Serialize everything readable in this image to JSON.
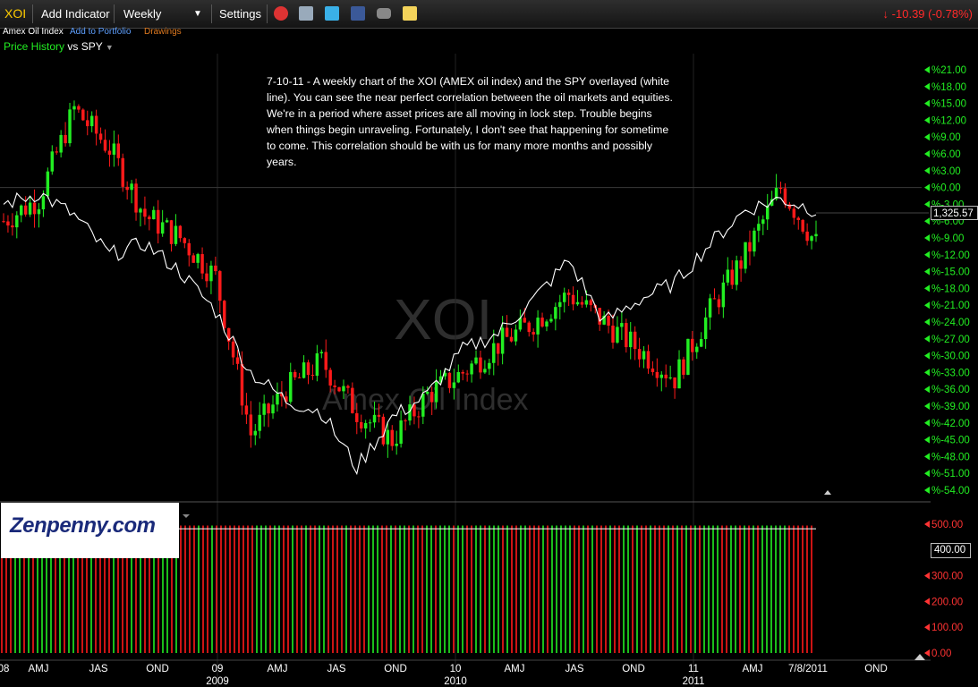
{
  "toolbar": {
    "ticker": "XOI",
    "add_indicator": "Add Indicator",
    "period": "Weekly",
    "period_caret": "▼",
    "settings": "Settings",
    "change": "-10.39 (-0.78%)",
    "change_arrow": "↓",
    "icons": [
      "alarm-clock-icon",
      "notes-icon",
      "twitter-icon",
      "facebook-icon",
      "camera-icon",
      "sticky-note-icon"
    ]
  },
  "subheader": {
    "name": "Amex Oil Index",
    "add_portfolio": "Add to Portfolio",
    "drawings": "Drawings"
  },
  "study": {
    "label": "Price History",
    "compare": "vs SPY",
    "caret": "▼"
  },
  "annotation": "7-10-11 - A weekly chart of the XOI (AMEX oil index) and the SPY overlayed (white line). You can see the near perfect correlation between the oil markets and equities. We're in a period where asset prices are all moving in lock step. Trouble begins when things begin unraveling. Fortunately, I don't see that happening for sometime to come. This correlation should be with us for many more months and possibly years.",
  "watermark": {
    "symbol": "XOI",
    "name": "Amex Oil Index"
  },
  "logo": {
    "text": "Zenpenny.com"
  },
  "current_price": "1,325.57",
  "volume_box": "400.00",
  "colors": {
    "up": "#22ee22",
    "down": "#ff1a1a",
    "spy": "#ffffff",
    "change": "#ff2a2a"
  },
  "chart_data": {
    "type": "line",
    "title": "",
    "y_ticks_pct": [
      "%21.00",
      "%18.00",
      "%15.00",
      "%12.00",
      "%9.00",
      "%6.00",
      "%3.00",
      "%0.00",
      "%-3.00",
      "%-6.00",
      "%-9.00",
      "%-12.00",
      "%-15.00",
      "%-18.00",
      "%-21.00",
      "%-24.00",
      "%-27.00",
      "%-30.00",
      "%-33.00",
      "%-36.00",
      "%-39.00",
      "%-42.00",
      "%-45.00",
      "%-48.00",
      "%-51.00",
      "%-54.00"
    ],
    "volume_ticks": [
      "500.00",
      "400.00",
      "300.00",
      "200.00",
      "100.00",
      "0.00"
    ],
    "x_labels": [
      "08",
      "AMJ",
      "JAS",
      "OND",
      "09",
      "AMJ",
      "JAS",
      "OND",
      "10",
      "AMJ",
      "JAS",
      "OND",
      "11",
      "AMJ",
      "7/8/2011",
      "OND"
    ],
    "x_years": [
      "2009",
      "2010",
      "2011"
    ],
    "series": [
      {
        "name": "Price History",
        "x": [
          0,
          8,
          16,
          24,
          32,
          40,
          48,
          56,
          64,
          72,
          80,
          88,
          96,
          104,
          112,
          120,
          128,
          136,
          144,
          152,
          160,
          168,
          176,
          184
        ],
        "values": [
          -6,
          -2,
          14,
          7,
          -5,
          -9,
          -16,
          -44,
          -36,
          -31,
          -40,
          -45,
          -37,
          -33,
          -28,
          -24,
          -19,
          -24,
          -29,
          -34,
          -22,
          -12,
          0,
          -10
        ]
      },
      {
        "name": "SPY",
        "x": [
          0,
          8,
          16,
          24,
          32,
          40,
          48,
          56,
          64,
          72,
          80,
          88,
          96,
          104,
          112,
          120,
          128,
          136,
          144,
          152,
          160,
          168,
          176,
          184
        ],
        "values": [
          -3,
          -1,
          -5,
          -12,
          -10,
          -15,
          -22,
          -33,
          -38,
          -40,
          -50,
          -41,
          -37,
          -29,
          -26,
          -20,
          -13,
          -24,
          -20,
          -17,
          -10,
          -4,
          -2,
          -4
        ]
      }
    ]
  }
}
